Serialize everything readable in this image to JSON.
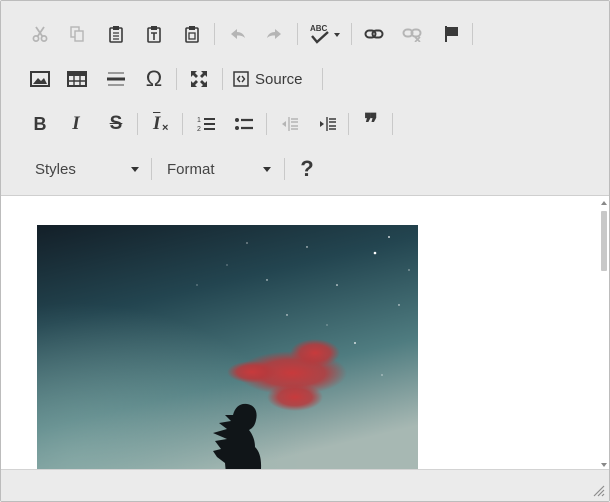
{
  "toolbar": {
    "row1": [
      {
        "name": "cut-button",
        "icon": "scissors-icon",
        "enabled": false
      },
      {
        "name": "copy-button",
        "icon": "copy-icon",
        "enabled": false
      },
      {
        "name": "paste-button",
        "icon": "clipboard-icon",
        "enabled": true
      },
      {
        "name": "paste-text-button",
        "icon": "clipboard-text-icon",
        "enabled": true
      },
      {
        "name": "paste-word-button",
        "icon": "clipboard-word-icon",
        "enabled": true
      },
      {
        "name": "undo-button",
        "icon": "undo-icon",
        "enabled": false
      },
      {
        "name": "redo-button",
        "icon": "redo-icon",
        "enabled": false
      },
      {
        "name": "spellcheck-button",
        "icon": "spellcheck-icon",
        "enabled": true
      },
      {
        "name": "link-button",
        "icon": "link-icon",
        "enabled": true
      },
      {
        "name": "unlink-button",
        "icon": "unlink-icon",
        "enabled": false
      },
      {
        "name": "anchor-button",
        "icon": "flag-icon",
        "enabled": true
      }
    ],
    "spellcheck_label": "ABC",
    "row2": [
      {
        "name": "image-button",
        "icon": "image-icon"
      },
      {
        "name": "table-button",
        "icon": "table-icon"
      },
      {
        "name": "horizontal-line-button",
        "icon": "horizontal-line-icon"
      },
      {
        "name": "special-char-button",
        "icon": "omega-icon"
      },
      {
        "name": "maximize-button",
        "icon": "maximize-icon"
      }
    ],
    "omega_glyph": "Ω",
    "source_label": "Source",
    "row3": [
      {
        "name": "bold-button",
        "icon": "bold-icon",
        "glyph": "B"
      },
      {
        "name": "italic-button",
        "icon": "italic-icon",
        "glyph": "I"
      },
      {
        "name": "strike-button",
        "icon": "strikethrough-icon",
        "glyph": "S"
      },
      {
        "name": "remove-format-button",
        "icon": "remove-format-icon",
        "glyph": "I"
      },
      {
        "name": "numbered-list-button",
        "icon": "numbered-list-icon"
      },
      {
        "name": "bulleted-list-button",
        "icon": "bulleted-list-icon"
      },
      {
        "name": "outdent-button",
        "icon": "outdent-icon",
        "enabled": false
      },
      {
        "name": "indent-button",
        "icon": "indent-icon"
      },
      {
        "name": "blockquote-button",
        "icon": "quote-icon",
        "glyph": "❞"
      }
    ],
    "list_numbers": [
      "1",
      "2"
    ],
    "row4": {
      "styles_label": "Styles",
      "format_label": "Format",
      "help_glyph": "?"
    }
  },
  "content": {
    "image": {
      "name": "night-sky-photo",
      "alt": ""
    }
  },
  "colors": {
    "toolbar_bg": "#ebebeb",
    "icon": "#3a3a3a",
    "icon_disabled": "#b5b5b5",
    "separator": "#c9c9c9",
    "sky_top": "#152630",
    "sky_mid": "#2f5c66",
    "sky_bottom": "#8fa6a4",
    "cloud": "#c83a3c"
  }
}
